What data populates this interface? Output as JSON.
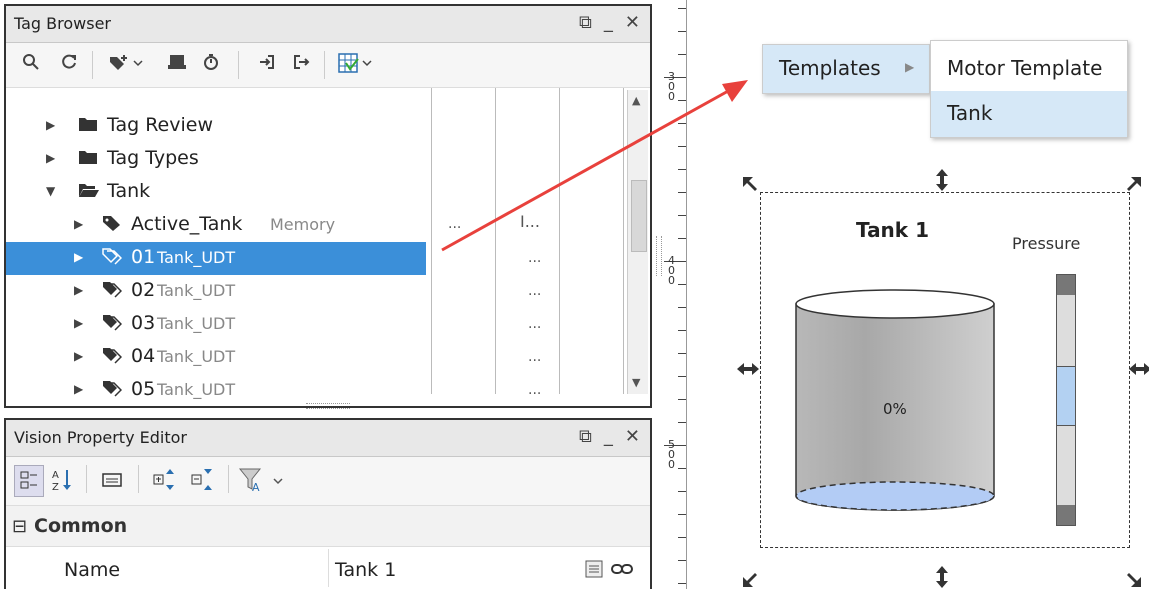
{
  "tag_browser": {
    "title": "Tag Browser",
    "win_buttons": [
      "⧉",
      "_",
      "✕"
    ],
    "tree": [
      {
        "label": "Tag Review",
        "type": "folder",
        "expanded": false
      },
      {
        "label": "Tag Types",
        "type": "folder",
        "expanded": false
      },
      {
        "label": "Tank",
        "type": "folder",
        "expanded": true
      },
      {
        "label": "Active_Tank",
        "sub": "Memory",
        "type": "tag",
        "col2": "...",
        "col3": "I..."
      },
      {
        "label": "01",
        "sub": "Tank_UDT",
        "type": "udt",
        "selected": true,
        "col3": "..."
      },
      {
        "label": "02",
        "sub": "Tank_UDT",
        "type": "udt",
        "col3": "..."
      },
      {
        "label": "03",
        "sub": "Tank_UDT",
        "type": "udt",
        "col3": "..."
      },
      {
        "label": "04",
        "sub": "Tank_UDT",
        "type": "udt",
        "col3": "..."
      },
      {
        "label": "05",
        "sub": "Tank_UDT",
        "type": "udt",
        "col3": "..."
      }
    ]
  },
  "property_editor": {
    "title": "Vision Property Editor",
    "win_buttons": [
      "⧉",
      "_",
      "✕"
    ],
    "section": "Common",
    "section_toggle": "⊟",
    "name_label": "Name",
    "name_value": "Tank 1"
  },
  "canvas": {
    "ruler_labels": [
      "3\n0\n0",
      "4\n0\n0",
      "5\n0\n0"
    ],
    "context_menu": {
      "templates_label": "Templates",
      "submenu_arrow": "▶",
      "submenu_items": [
        "Motor Template",
        "Tank"
      ]
    },
    "tank": {
      "title": "Tank 1",
      "fill_text": "0%",
      "pressure_label": "Pressure",
      "level": 0
    }
  },
  "colors": {
    "selection": "#3b8fd9",
    "arrow": "#e8413c",
    "menu_highlight": "#d6e8f7",
    "tank_fill": "#b3ccf5",
    "pressure_mid": "#b3d1f2"
  }
}
